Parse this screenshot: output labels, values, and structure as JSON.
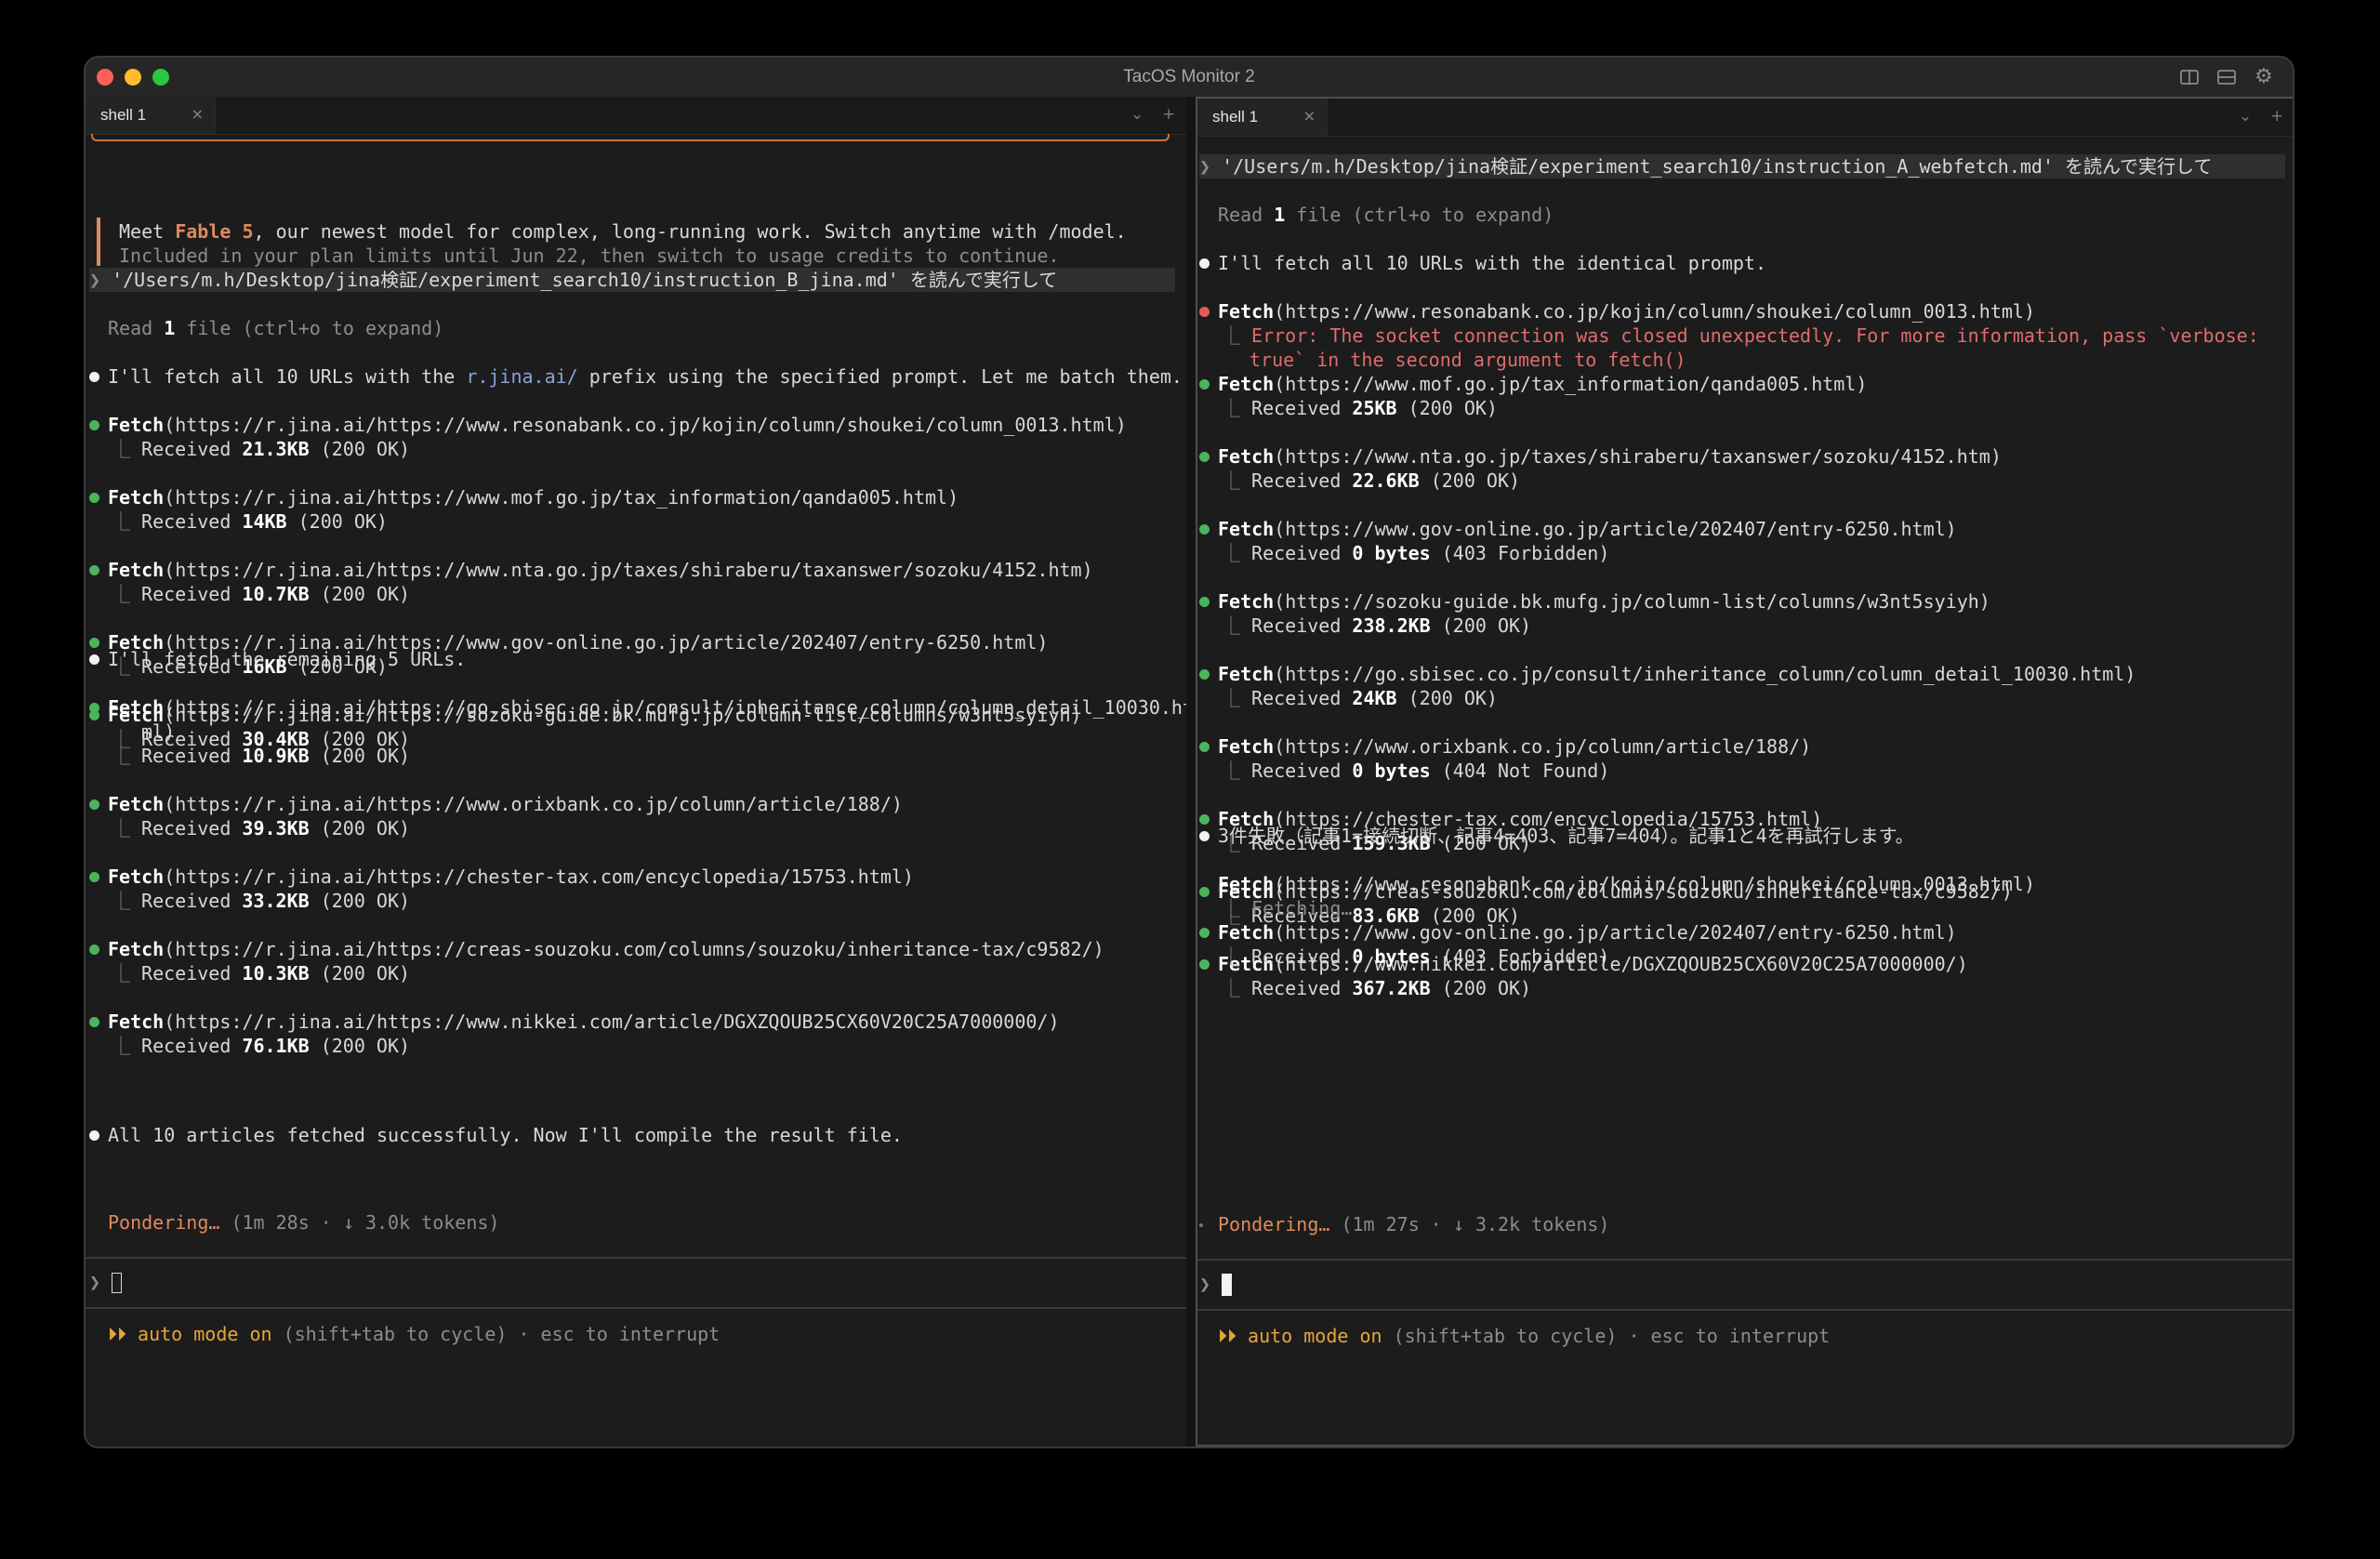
{
  "window": {
    "title": "TacOS Monitor 2"
  },
  "colors": {
    "accent_orange": "#e08a5c",
    "success_green": "#4cb45c",
    "error_red": "#e25c5c",
    "link_blue": "#8aa2d8",
    "auto_mode_amber": "#e5a63a"
  },
  "left": {
    "tab": {
      "label": "shell 1",
      "close": "×"
    },
    "tabbar_controls": {
      "chevron": "⌄",
      "plus": "+"
    },
    "notice": {
      "meet": "Meet ",
      "model": "Fable 5",
      "rest": ", our newest model for complex, long-running work. Switch anytime with /model.",
      "line2": "Included in your plan limits until Jun 22, then switch to usage credits to continue."
    },
    "prompt_symbol": "❯",
    "prompt": " '/Users/m.h/Desktop/jina検証/experiment_search10/instruction_B_jina.md' を読んで実行して",
    "read": {
      "pre": "Read ",
      "count": "1",
      "post": " file (ctrl+o to expand)"
    },
    "msg1": {
      "pre": "I'll fetch all 10 URLs with the ",
      "link": "r.jina.ai/",
      "post": " prefix using the specified prompt. Let me batch them."
    },
    "fetches_a": [
      {
        "tool": "Fetch",
        "url": "(https://r.jina.ai/https://www.resonabank.co.jp/kojin/column/shoukei/column_0013.html)",
        "size": "21.3KB",
        "status": " (200 OK)"
      },
      {
        "tool": "Fetch",
        "url": "(https://r.jina.ai/https://www.mof.go.jp/tax_information/qanda005.html)",
        "size": "14KB",
        "status": " (200 OK)"
      },
      {
        "tool": "Fetch",
        "url": "(https://r.jina.ai/https://www.nta.go.jp/taxes/shiraberu/taxanswer/sozoku/4152.htm)",
        "size": "10.7KB",
        "status": " (200 OK)"
      },
      {
        "tool": "Fetch",
        "url": "(https://r.jina.ai/https://www.gov-online.go.jp/article/202407/entry-6250.html)",
        "size": "16KB",
        "status": " (200 OK)"
      },
      {
        "tool": "Fetch",
        "url": "(https://r.jina.ai/https://sozoku-guide.bk.mufg.jp/column-list/columns/w3nt5syiyh)",
        "size": "30.4KB",
        "status": " (200 OK)"
      }
    ],
    "msg2": "I'll fetch the remaining 5 URLs.",
    "fetch6": {
      "tool": "Fetch",
      "url": "(https://r.jina.ai/https://go.sbisec.co.jp/consult/inheritance_column/column_detail_10030.ht",
      "url_wrap": "ml)",
      "size": "10.9KB",
      "status": " (200 OK)"
    },
    "fetches_b": [
      {
        "tool": "Fetch",
        "url": "(https://r.jina.ai/https://www.orixbank.co.jp/column/article/188/)",
        "size": "39.3KB",
        "status": " (200 OK)"
      },
      {
        "tool": "Fetch",
        "url": "(https://r.jina.ai/https://chester-tax.com/encyclopedia/15753.html)",
        "size": "33.2KB",
        "status": " (200 OK)"
      },
      {
        "tool": "Fetch",
        "url": "(https://r.jina.ai/https://creas-souzoku.com/columns/souzoku/inheritance-tax/c9582/)",
        "size": "10.3KB",
        "status": " (200 OK)"
      },
      {
        "tool": "Fetch",
        "url": "(https://r.jina.ai/https://www.nikkei.com/article/DGXZQOUB25CX60V20C25A7000000/)",
        "size": "76.1KB",
        "status": " (200 OK)"
      }
    ],
    "msg3": "All 10 articles fetched successfully. Now I'll compile the result file.",
    "pondering": {
      "label": "Pondering…",
      "detail": " (1m 28s · ↓ 3.0k tokens)"
    },
    "received_label": "Received ",
    "branch": "⎿",
    "auto_mode": {
      "arrows": "⏵⏵",
      "label": " auto mode on",
      "hint": " (shift+tab to cycle) · esc to interrupt"
    }
  },
  "right": {
    "tab": {
      "label": "shell 1",
      "close": "×"
    },
    "tabbar_controls": {
      "chevron": "⌄",
      "plus": "+"
    },
    "prompt_symbol": "❯",
    "prompt": " '/Users/m.h/Desktop/jina検証/experiment_search10/instruction_A_webfetch.md' を読んで実行して",
    "read": {
      "pre": "Read ",
      "count": "1",
      "post": " file (ctrl+o to expand)"
    },
    "msg1": "I'll fetch all 10 URLs with the identical prompt.",
    "fetch_err": {
      "tool": "Fetch",
      "url": "(https://www.resonabank.co.jp/kojin/column/shoukei/column_0013.html)",
      "error1": "Error: The socket connection was closed unexpectedly. For more information, pass `verbose:",
      "error2": "true` in the second argument to fetch()"
    },
    "fetches": [
      {
        "tool": "Fetch",
        "url": "(https://www.mof.go.jp/tax_information/qanda005.html)",
        "size": "25KB",
        "status": " (200 OK)"
      },
      {
        "tool": "Fetch",
        "url": "(https://www.nta.go.jp/taxes/shiraberu/taxanswer/sozoku/4152.htm)",
        "size": "22.6KB",
        "status": " (200 OK)"
      },
      {
        "tool": "Fetch",
        "url": "(https://www.gov-online.go.jp/article/202407/entry-6250.html)",
        "size": "0 bytes",
        "status": " (403 Forbidden)"
      },
      {
        "tool": "Fetch",
        "url": "(https://sozoku-guide.bk.mufg.jp/column-list/columns/w3nt5syiyh)",
        "size": "238.2KB",
        "status": " (200 OK)"
      },
      {
        "tool": "Fetch",
        "url": "(https://go.sbisec.co.jp/consult/inheritance_column/column_detail_10030.html)",
        "size": "24KB",
        "status": " (200 OK)"
      },
      {
        "tool": "Fetch",
        "url": "(https://www.orixbank.co.jp/column/article/188/)",
        "size": "0 bytes",
        "status": " (404 Not Found)"
      },
      {
        "tool": "Fetch",
        "url": "(https://chester-tax.com/encyclopedia/15753.html)",
        "size": "159.3KB",
        "status": " (200 OK)"
      },
      {
        "tool": "Fetch",
        "url": "(https://creas-souzoku.com/columns/souzoku/inheritance-tax/c9582/)",
        "size": "83.6KB",
        "status": " (200 OK)"
      },
      {
        "tool": "Fetch",
        "url": "(https://www.nikkei.com/article/DGXZQOUB25CX60V20C25A7000000/)",
        "size": "367.2KB",
        "status": " (200 OK)"
      }
    ],
    "msg2": "3件失敗（記事1=接続切断、記事4=403、記事7=404）。記事1と4を再試行します。",
    "fetch_pending": {
      "tool": "Fetch",
      "url": "(https://www.resonabank.co.jp/kojin/column/shoukei/column_0013.html)",
      "status": "Fetching…"
    },
    "fetch_retry": {
      "tool": "Fetch",
      "url": "(https://www.gov-online.go.jp/article/202407/entry-6250.html)",
      "size": "0 bytes",
      "status": " (403 Forbidden)"
    },
    "pondering": {
      "label": "Pondering…",
      "detail": " (1m 27s · ↓ 3.2k tokens)"
    },
    "received_label": "Received ",
    "branch": "⎿",
    "auto_mode": {
      "arrows": "⏵⏵",
      "label": " auto mode on",
      "hint": " (shift+tab to cycle) · esc to interrupt"
    }
  }
}
